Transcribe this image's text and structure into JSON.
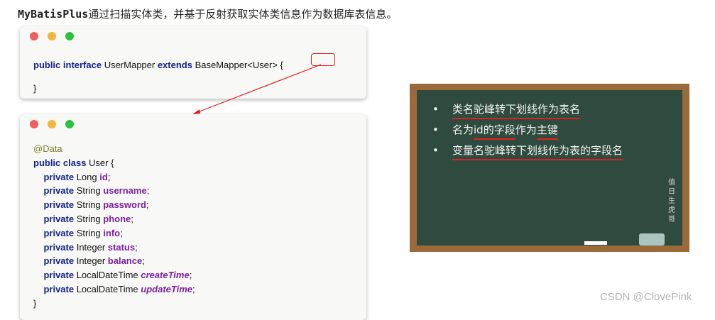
{
  "heading": {
    "code_part": "MyBatisPlus",
    "text_part": "通过扫描实体类，并基于反射获取实体类信息作为数据库表信息。"
  },
  "mapper_window": {
    "line1": {
      "kw1": "public interface",
      "t1": " UserMapper ",
      "kw2": "extends",
      "t2": " BaseMapper<User> {"
    },
    "line2": "}"
  },
  "entity_window": {
    "annotation": "@Data",
    "class_line": {
      "kw": "public class",
      "rest": " User {"
    },
    "fields": [
      {
        "mod": "private",
        "type": " Long ",
        "name": "id",
        "end": ";"
      },
      {
        "mod": "private",
        "type": " String ",
        "name": "username",
        "end": ";"
      },
      {
        "mod": "private",
        "type": " String ",
        "name": "password",
        "end": ";"
      },
      {
        "mod": "private",
        "type": " String ",
        "name": "phone",
        "end": ";"
      },
      {
        "mod": "private",
        "type": " String ",
        "name": "info",
        "end": ";"
      },
      {
        "mod": "private",
        "type": " Integer ",
        "name": "status",
        "end": ";"
      },
      {
        "mod": "private",
        "type": " Integer ",
        "name": "balance",
        "end": ";"
      },
      {
        "mod": "private",
        "type": " LocalDateTime ",
        "name": "createTime",
        "end": ";"
      },
      {
        "mod": "private",
        "type": " LocalDateTime ",
        "name": "updateTime",
        "end": ";"
      }
    ],
    "close": "}"
  },
  "blackboard": {
    "bullet": "•",
    "items": [
      {
        "text": "类名驼峰转下划线作为表名"
      },
      {
        "a": "名为",
        "b": "id的字段",
        "c": "作为",
        "d": "主键"
      },
      {
        "text": "变量名驼峰转下划线作为表的字段名"
      }
    ],
    "signature": "值 日 生 虎 哥"
  },
  "watermark": "CSDN @ClovePink"
}
